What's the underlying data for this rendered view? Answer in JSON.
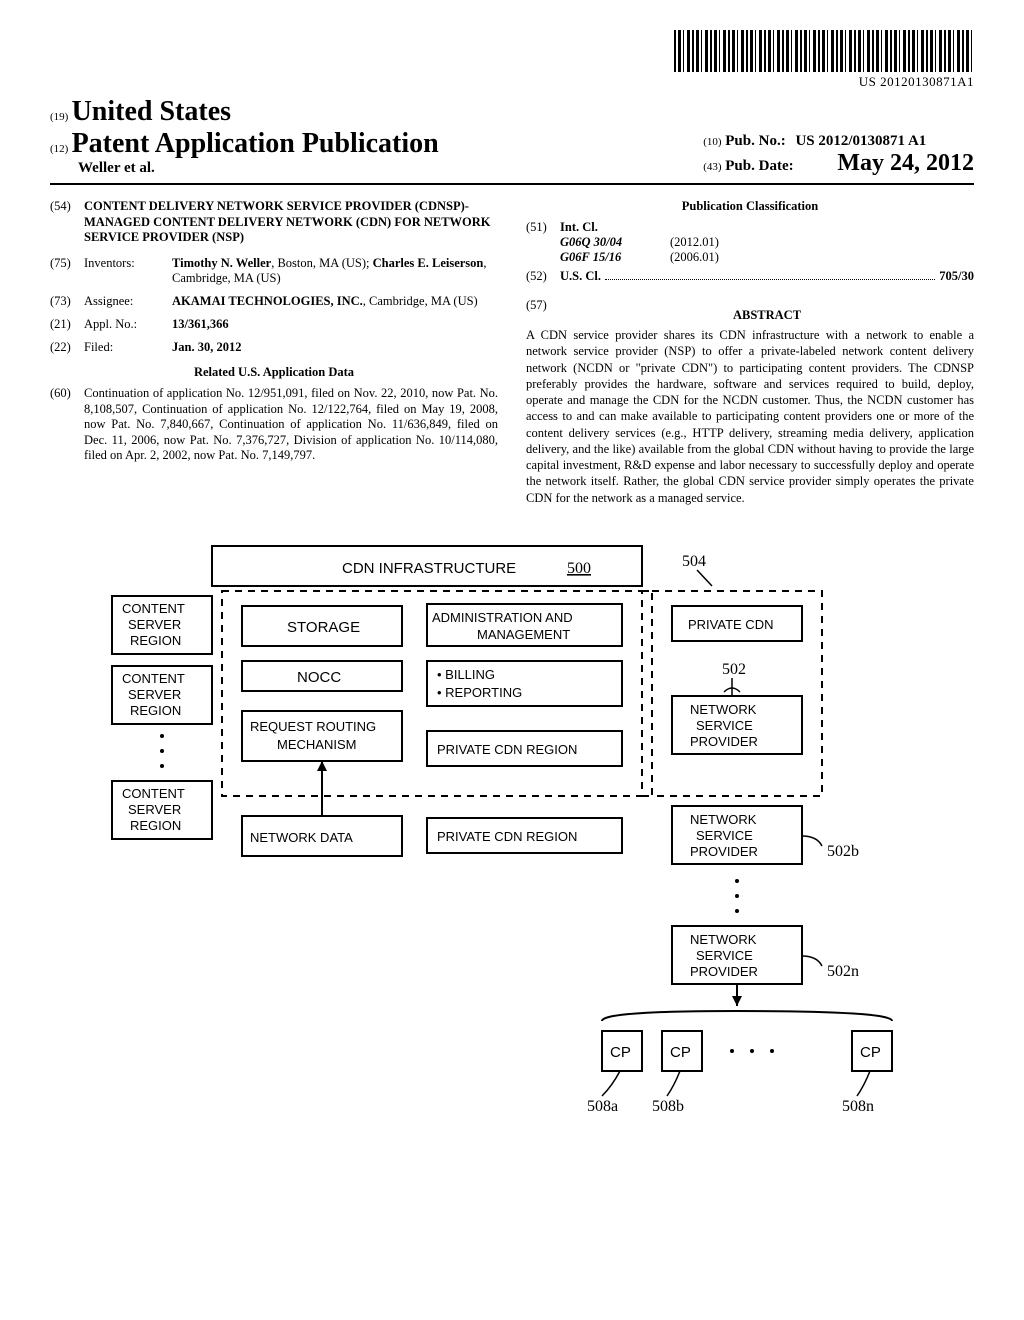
{
  "header": {
    "pub_id_under_barcode": "US 20120130871A1",
    "country_code": "(19)",
    "country": "United States",
    "pubtype_code": "(12)",
    "pubtype": "Patent Application Publication",
    "authors_line": "Weller et al.",
    "pubno_code": "(10)",
    "pubno_label": "Pub. No.:",
    "pubno": "US 2012/0130871 A1",
    "pubdate_code": "(43)",
    "pubdate_label": "Pub. Date:",
    "pubdate": "May 24, 2012"
  },
  "left": {
    "title_code": "(54)",
    "title": "CONTENT DELIVERY NETWORK SERVICE PROVIDER (CDNSP)-MANAGED CONTENT DELIVERY NETWORK (CDN) FOR NETWORK SERVICE PROVIDER (NSP)",
    "inventors_code": "(75)",
    "inventors_label": "Inventors:",
    "inventors_val_1": "Timothy N. Weller",
    "inventors_val_1b": ", Boston, MA (US); ",
    "inventors_val_2": "Charles E. Leiserson",
    "inventors_val_2b": ", Cambridge, MA (US)",
    "assignee_code": "(73)",
    "assignee_label": "Assignee:",
    "assignee_val_1": "AKAMAI TECHNOLOGIES, INC.",
    "assignee_val_1b": ", Cambridge, MA (US)",
    "applno_code": "(21)",
    "applno_label": "Appl. No.:",
    "applno_val": "13/361,366",
    "filed_code": "(22)",
    "filed_label": "Filed:",
    "filed_val": "Jan. 30, 2012",
    "related_head": "Related U.S. Application Data",
    "related_code": "(60)",
    "related_body": "Continuation of application No. 12/951,091, filed on Nov. 22, 2010, now Pat. No. 8,108,507, Continuation of application No. 12/122,764, filed on May 19, 2008, now Pat. No. 7,840,667, Continuation of application No. 11/636,849, filed on Dec. 11, 2006, now Pat. No. 7,376,727, Division of application No. 10/114,080, filed on Apr. 2, 2002, now Pat. No. 7,149,797."
  },
  "right": {
    "pubclass_head": "Publication Classification",
    "intcl_code": "(51)",
    "intcl_label": "Int. Cl.",
    "intcl_1": "G06Q 30/04",
    "intcl_1b": "(2012.01)",
    "intcl_2": "G06F 15/16",
    "intcl_2b": "(2006.01)",
    "uscl_code": "(52)",
    "uscl_label": "U.S. Cl.",
    "uscl_val": "705/30",
    "abstract_code": "(57)",
    "abstract_head": "ABSTRACT",
    "abstract_body": "A CDN service provider shares its CDN infrastructure with a network to enable a network service provider (NSP) to offer a private-labeled network content delivery network (NCDN or \"private CDN\") to participating content providers. The CDNSP preferably provides the hardware, software and services required to build, deploy, operate and manage the CDN for the NCDN customer. Thus, the NCDN customer has access to and can make available to participating content providers one or more of the content delivery services (e.g., HTTP delivery, streaming media delivery, application delivery, and the like) available from the global CDN without having to provide the large capital investment, R&D expense and labor necessary to successfully deploy and operate the network itself. Rather, the global CDN service provider simply operates the private CDN for the network as a managed service."
  },
  "figure": {
    "cdn_infra_title": "CDN INFRASTRUCTURE",
    "ref_500": "500",
    "ref_504": "504",
    "ref_502": "502",
    "ref_502b": "502b",
    "ref_502n": "502n",
    "ref_508a": "508a",
    "ref_508b": "508b",
    "ref_508n": "508n",
    "content_server_region": "CONTENT\nSERVER\nREGION",
    "storage": "STORAGE",
    "nocc": "NOCC",
    "request_routing": "REQUEST ROUTING\nMECHANISM",
    "network_data": "NETWORK DATA",
    "admin_mgmt": "ADMINISTRATION AND\nMANAGEMENT",
    "billing": "• BILLING",
    "reporting": "• REPORTING",
    "private_cdn_region": "PRIVATE CDN REGION",
    "private_cdn": "PRIVATE CDN",
    "nsp": "NETWORK\nSERVICE\nPROVIDER",
    "cp": "CP"
  }
}
